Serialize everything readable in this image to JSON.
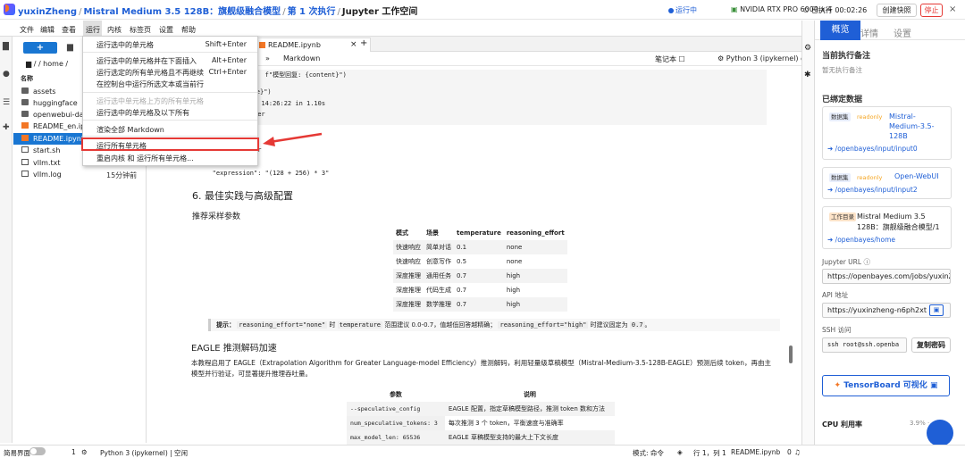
{
  "header": {
    "user": "yuxinZheng",
    "project": "Mistral Medium 3.5 128B：旗舰级融合模型",
    "run": "第 1 次执行",
    "page": "Jupyter 工作空间",
    "status": "运行中",
    "gpu": "NVIDIA RTX PRO 6000 x 4",
    "elapsed": "已执行 00:02:26",
    "snapshot": "创建快照",
    "stop": "停止",
    "close": "×"
  },
  "menubar": [
    "文件",
    "编辑",
    "查看",
    "运行",
    "内核",
    "标签页",
    "设置",
    "帮助"
  ],
  "filebrowser": {
    "new_label": "+",
    "path": "/ / home /",
    "col_name": "名称",
    "files": [
      {
        "name": "assets",
        "kind": "folder",
        "time": ""
      },
      {
        "name": "huggingface",
        "kind": "folder",
        "time": ""
      },
      {
        "name": "openwebui-data",
        "kind": "folder",
        "time": ""
      },
      {
        "name": "README_en.ipynb",
        "kind": "notebook",
        "time": ""
      },
      {
        "name": "README.ipynb",
        "kind": "notebook",
        "time": ""
      },
      {
        "name": "start.sh",
        "kind": "file",
        "time": ""
      },
      {
        "name": "vllm.txt",
        "kind": "file",
        "time": ""
      },
      {
        "name": "vllm.log",
        "kind": "file",
        "time": "15分钟前"
      }
    ]
  },
  "notebook": {
    "tab": "README.ipynb",
    "cell_type": "Markdown",
    "notebook_label": "笔记本 ☐",
    "kernel": "Python 3 (ipykernel) ○",
    "code_lines": [
      "                 f\"模型回复: {content}\")",
      "          s e:",
      "          误: {e}\")",
      "          05-08 14:26:22 in 1.10s",
      "          weather",
      "",
      "          ulator",
      "",
      "   \"expression\": \"(128 + 256) * 3\"",
      ")"
    ],
    "heading6": "6. 最佳实践与高级配置",
    "params_heading": "推荐采样参数",
    "params_headers": [
      "模式",
      "场景",
      "temperature",
      "reasoning_effort"
    ],
    "params_rows": [
      [
        "快速响应",
        "简单对话",
        "0.1",
        "none"
      ],
      [
        "快速响应",
        "创意写作",
        "0.5",
        "none"
      ],
      [
        "深度推理",
        "通用任务",
        "0.7",
        "high"
      ],
      [
        "深度推理",
        "代码生成",
        "0.7",
        "high"
      ],
      [
        "深度推理",
        "数学推理",
        "0.7",
        "high"
      ]
    ],
    "tip_prefix": "提示：",
    "tip_code1": "reasoning_effort=\"none\"",
    "tip_mid1": "时",
    "tip_code2": "temperature",
    "tip_mid2": "范围建议 0.0-0.7，值越低回答越精确；",
    "tip_code3": "reasoning_effort=\"high\"",
    "tip_mid3": "时建议固定为",
    "tip_code4": "0.7",
    "tip_end": "。",
    "eagle_heading": "EAGLE 推测解码加速",
    "eagle_text": "本教程启用了 EAGLE（Extrapolation Algorithm for Greater Language-model Efficiency）推测解码，利用轻量级草稿模型（Mistral-Medium-3.5-128B-EAGLE）预测后续 token，再由主模型并行验证，可显著提升推理吞吐量。",
    "eagle_headers": [
      "参数",
      "说明"
    ],
    "eagle_rows": [
      [
        "--speculative_config",
        "EAGLE 配置，指定草稿模型路径，推测 token 数和方法"
      ],
      [
        "num_speculative_tokens: 3",
        "每次推测 3 个 token，平衡速度与准确率"
      ],
      [
        "max_model_len: 65536",
        "EAGLE 草稿模型支持的最大上下文长度"
      ]
    ]
  },
  "run_menu": {
    "items": [
      {
        "label": "运行选中的单元格",
        "key": "Shift+Enter",
        "disabled": false
      },
      {
        "label": "运行选中的单元格并在下面插入",
        "key": "Alt+Enter",
        "disabled": false
      },
      {
        "label": "运行选定的所有单元格且不再继续",
        "key": "Ctrl+Enter",
        "disabled": false
      },
      {
        "label": "在控制台中运行所选文本或当前行",
        "key": "",
        "disabled": false
      },
      {
        "label": "运行选中单元格上方的所有单元格",
        "key": "",
        "disabled": true
      },
      {
        "label": "运行选中的单元格及以下所有",
        "key": "",
        "disabled": false
      },
      {
        "label": "渲染全部 Markdown",
        "key": "",
        "disabled": false
      },
      {
        "label": "运行所有单元格",
        "key": "",
        "disabled": false
      },
      {
        "label": "重启内核 和 运行所有单元格...",
        "key": "",
        "disabled": false
      }
    ]
  },
  "right_panel": {
    "tabs": [
      "概览",
      "详情",
      "设置"
    ],
    "note_title": "当前执行备注",
    "note_empty": "暂无执行备注",
    "bound_title": "已绑定数据",
    "bindings": [
      {
        "tag": "数据集",
        "ro": "readonly",
        "name": "Mistral-Medium-3.5-128B",
        "path": "➜ /openbayes/input/input0"
      },
      {
        "tag": "数据集",
        "ro": "readonly",
        "name": "Open-WebUI",
        "path": "➜ /openbayes/input/input2"
      },
      {
        "tag": "工作目录",
        "ro": "",
        "name": "Mistral Medium 3.5 128B：旗舰级融合模型/1",
        "path": "➜ /openbayes/home"
      }
    ],
    "jupyter_label": "Jupyter URL ⓘ",
    "jupyter_url": "https://openbayes.com/jobs/yuxinZh",
    "api_label": "API 地址",
    "api_url": "https://yuxinzheng-n6ph2xt",
    "ssh_label": "SSH 访问",
    "ssh_cmd": "ssh root@ssh.openba",
    "copy_label": "复制密码",
    "tensorboard": "TensorBoard 可视化",
    "cpu_label": "CPU 利用率",
    "cpu_value": "3.9% ·"
  },
  "statusbar": {
    "simple": "简易界面",
    "count": "1",
    "kernel": "Python 3 (ipykernel) | 空闲",
    "mode": "模式: 命令",
    "pos": "行 1，列 1",
    "file": "README.ipynb",
    "bell": "0"
  }
}
